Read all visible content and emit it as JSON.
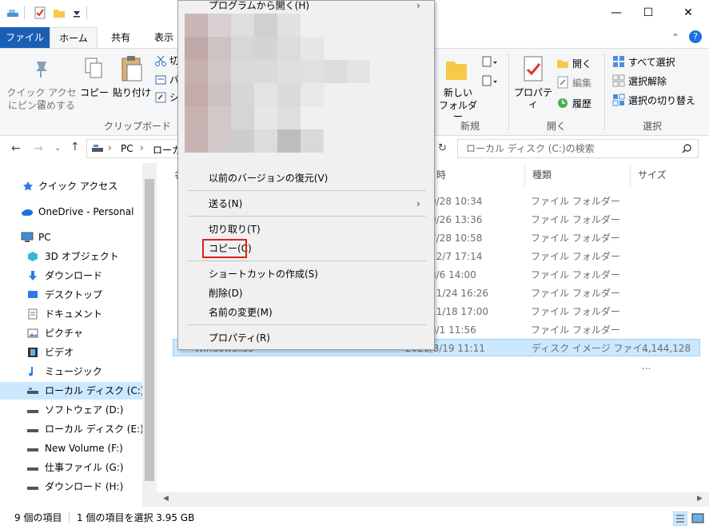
{
  "window": {
    "minimize": "—",
    "maximize": "☐",
    "close": "✕",
    "help": "?"
  },
  "tabs": [
    "ファイル",
    "ホーム",
    "共有",
    "表示"
  ],
  "ribbon": {
    "pin_label_1": "クイック アクセス",
    "pin_label_2": "にピン留めする",
    "copy": "コピー",
    "paste": "貼り付け",
    "cut_partial": "切",
    "path_partial": "パ",
    "shortcut_partial": "シ",
    "group_clipboard": "クリップボード",
    "new_folder_1": "新しい",
    "new_folder_2": "フォルダー",
    "group_new": "新規",
    "properties": "プロパティ",
    "open": "開く",
    "edit": "編集",
    "history": "履歴",
    "group_open": "開く",
    "select_all": "すべて選択",
    "select_none": "選択解除",
    "invert_selection": "選択の切り替え",
    "group_select": "選択"
  },
  "address": {
    "pc": "PC",
    "drive": "ローカル",
    "search_placeholder": "ローカル ディスク (C:)の検索"
  },
  "nav": [
    {
      "label": "クイック アクセス",
      "icon": "star-icon"
    },
    {
      "label": "OneDrive - Personal",
      "icon": "cloud-icon"
    },
    {
      "label": "PC",
      "icon": "computer-icon"
    },
    {
      "label": "3D オブジェクト",
      "icon": "cube-icon"
    },
    {
      "label": "ダウンロード",
      "icon": "download-icon"
    },
    {
      "label": "デスクトップ",
      "icon": "desktop-icon"
    },
    {
      "label": "ドキュメント",
      "icon": "document-icon"
    },
    {
      "label": "ピクチャ",
      "icon": "picture-icon"
    },
    {
      "label": "ビデオ",
      "icon": "video-icon"
    },
    {
      "label": "ミュージック",
      "icon": "music-icon"
    },
    {
      "label": "ローカル ディスク (C:)",
      "icon": "drive-icon"
    },
    {
      "label": "ソフトウェア (D:)",
      "icon": "drive-icon"
    },
    {
      "label": "ローカル ディスク (E:)",
      "icon": "drive-icon"
    },
    {
      "label": "New Volume (F:)",
      "icon": "drive-icon"
    },
    {
      "label": "仕事ファイル (G:)",
      "icon": "drive-icon"
    },
    {
      "label": "ダウンロード (H:)",
      "icon": "drive-icon"
    }
  ],
  "columns": {
    "name_partial": "名",
    "date_partial": "時",
    "type": "種類",
    "size": "サイズ"
  },
  "rows": [
    {
      "date": "9/28 10:34",
      "type": "ファイル フォルダー",
      "size": ""
    },
    {
      "date": "9/26 13:36",
      "type": "ファイル フォルダー",
      "size": ""
    },
    {
      "date": "7/28 10:58",
      "type": "ファイル フォルダー",
      "size": ""
    },
    {
      "date": "12/7 17:14",
      "type": "ファイル フォルダー",
      "size": ""
    },
    {
      "date": "8/6 14:00",
      "type": "ファイル フォルダー",
      "size": ""
    },
    {
      "date": "11/24 16:26",
      "type": "ファイル フォルダー",
      "size": ""
    },
    {
      "date": "11/18 17:00",
      "type": "ファイル フォルダー",
      "size": ""
    },
    {
      "date": "8/1 11:56",
      "type": "ファイル フォルダー",
      "size": ""
    },
    {
      "date": "2020/8/19 11:11",
      "type": "ディスク イメージ ファイ...",
      "size": "4,144,128 ..."
    }
  ],
  "selected_name_partial": "Windows.iso",
  "context_menu": {
    "open_with": "プログラムから開く(H)",
    "restore": "以前のバージョンの復元(V)",
    "send_to": "送る(N)",
    "cut": "切り取り(T)",
    "copy": "コピー(C)",
    "create_shortcut": "ショートカットの作成(S)",
    "delete": "削除(D)",
    "rename": "名前の変更(M)",
    "properties": "プロパティ(R)"
  },
  "status": {
    "count": "9 個の項目",
    "selected": "1 個の項目を選択  3.95 GB"
  },
  "colors": {
    "accent": "#1a5fb4",
    "selection": "#cce8ff",
    "highlight_box": "#e0201b"
  }
}
